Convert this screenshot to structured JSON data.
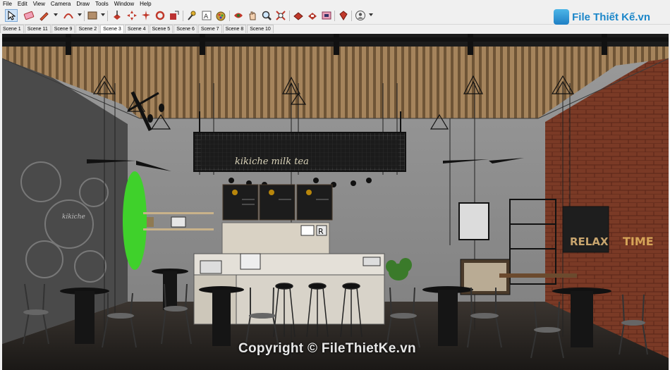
{
  "menu": [
    "File",
    "Edit",
    "View",
    "Camera",
    "Draw",
    "Tools",
    "Window",
    "Help"
  ],
  "toolbar": {
    "tools": [
      "select-tool-icon",
      "eraser-icon",
      "pencil-icon",
      "arc-icon",
      "rectangle-icon",
      "push-pull-icon",
      "move-icon",
      "rotate-icon",
      "scale-icon",
      "offset-icon",
      "tape-measure-icon",
      "text-icon",
      "paint-bucket-icon",
      "orbit-icon",
      "pan-icon",
      "zoom-icon",
      "zoom-extents-icon",
      "warehouse-icon",
      "extension-warehouse-icon",
      "layout-icon",
      "ruby-icon",
      "user-account-icon"
    ]
  },
  "scenes": [
    "Scene 1",
    "Scene 11",
    "Scene 9",
    "Scene 2",
    "Scene 3",
    "Scene 4",
    "Scene 5",
    "Scene 6",
    "Scene 7",
    "Scene 8",
    "Scene 10"
  ],
  "active_scene": "Scene 3",
  "logo": {
    "text": "File Thiết Kế.vn"
  },
  "scene_text": {
    "sign": "kikiche milk tea",
    "wall_left": "kikiche",
    "relax": "RELAX",
    "time": "TIME",
    "counter_letter": "R"
  },
  "watermark": "Copyright © FileThietKe.vn",
  "colors": {
    "brick": "#7a3a26",
    "concrete": "#8d8d8d",
    "ceiling": "#9a7a55",
    "surfboard": "#3fd12b"
  }
}
